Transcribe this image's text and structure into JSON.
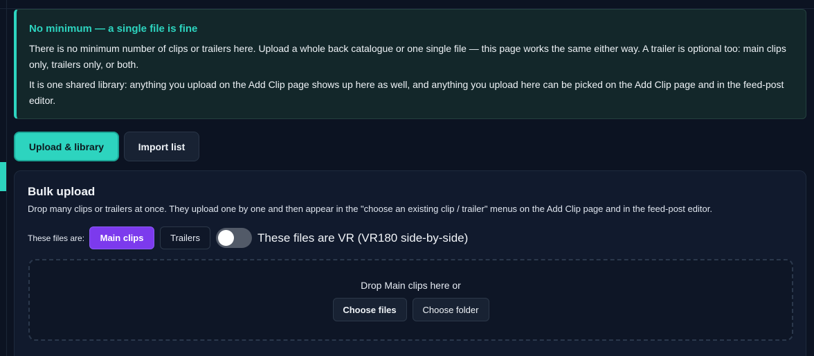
{
  "notice": {
    "title": "No minimum — a single file is fine",
    "paragraph1": "There is no minimum number of clips or trailers here. Upload a whole back catalogue or one single file — this page works the same either way. A trailer is optional too: main clips only, trailers only, or both.",
    "paragraph2": "It is one shared library: anything you upload on the Add Clip page shows up here as well, and anything you upload here can be picked on the Add Clip page and in the feed-post editor.",
    "accent_color": "#2dd4bf"
  },
  "tabs": [
    {
      "label": "Upload & library",
      "active": true
    },
    {
      "label": "Import list",
      "active": false
    }
  ],
  "bulk_upload": {
    "title": "Bulk upload",
    "description": "Drop many clips or trailers at once. They upload one by one and then appear in the \"choose an existing clip / trailer\" menus on the Add Clip page and in the feed-post editor.",
    "type_label": "These files are:",
    "type_options": [
      {
        "label": "Main clips",
        "selected": true
      },
      {
        "label": "Trailers",
        "selected": false
      }
    ],
    "vr_toggle": {
      "label": "These files are VR (VR180 side-by-side)",
      "on": false
    },
    "dropzone": {
      "text": "Drop Main clips here or",
      "choose_files_label": "Choose files",
      "choose_folder_label": "Choose folder"
    },
    "selected_color": "#7c3aed"
  }
}
